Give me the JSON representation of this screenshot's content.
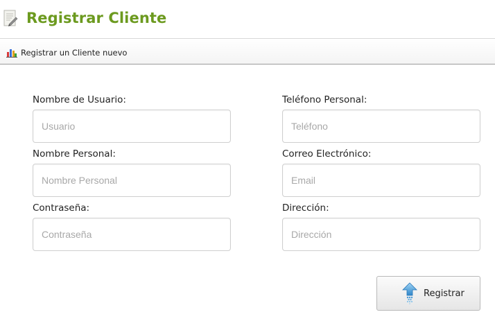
{
  "header": {
    "icon": "document-edit-icon",
    "title": "Registrar Cliente",
    "title_color": "#6c9a1f"
  },
  "subbar": {
    "icon": "bar-chart-icon",
    "label": "Registrar un Cliente nuevo"
  },
  "form": {
    "fields": {
      "username": {
        "label": "Nombre de Usuario:",
        "placeholder": "Usuario",
        "value": ""
      },
      "name": {
        "label": "Nombre Personal:",
        "placeholder": "Nombre Personal",
        "value": ""
      },
      "password": {
        "label": "Contraseña:",
        "placeholder": "Contraseña",
        "value": ""
      },
      "phone": {
        "label": "Teléfono Personal:",
        "placeholder": "Teléfono",
        "value": ""
      },
      "email": {
        "label": "Correo Electrónico:",
        "placeholder": "Email",
        "value": ""
      },
      "address": {
        "label": "Dirección:",
        "placeholder": "Dirección",
        "value": ""
      }
    },
    "submit": {
      "label": "Registrar",
      "icon": "upload-arrow-icon"
    }
  }
}
